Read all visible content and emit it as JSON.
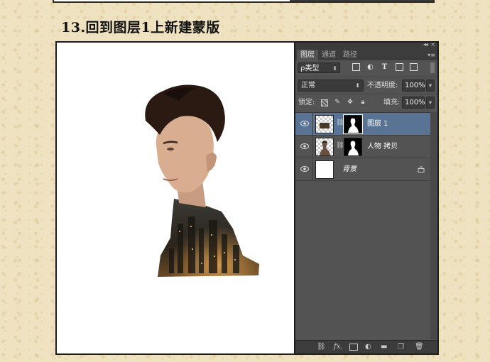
{
  "step_title": "13.回到图层1上新建蒙版",
  "panel": {
    "tabs": [
      "图层",
      "通道",
      "路径"
    ],
    "active_tab": "图层",
    "filter": {
      "label": "ρ类型",
      "icons": [
        "image-filter-icon",
        "adjustment-filter-icon",
        "type-filter-icon",
        "shape-filter-icon",
        "smart-object-filter-icon"
      ],
      "type_glyph": "T"
    },
    "blend_mode": "正常",
    "opacity_label": "不透明度:",
    "opacity_value": "100%",
    "lock_label": "锁定:",
    "fill_label": "填充:",
    "fill_value": "100%",
    "layers": [
      {
        "name": "图层 1",
        "selected": true,
        "has_mask": true,
        "thumb": "checker-city"
      },
      {
        "name": "人物 拷贝",
        "selected": false,
        "has_mask": true,
        "thumb": "checker-person"
      },
      {
        "name": "背景",
        "selected": false,
        "has_mask": false,
        "thumb": "white",
        "locked": true
      }
    ],
    "bottom_icons": [
      "link-icon",
      "fx-icon",
      "add-mask-icon",
      "adjustment-layer-icon",
      "group-folder-icon",
      "new-layer-icon",
      "trash-icon"
    ],
    "fx_label": "fx."
  },
  "colors": {
    "selected_row": "#597395",
    "panel_bg": "#535353",
    "page_bg": "#efe2c0"
  }
}
